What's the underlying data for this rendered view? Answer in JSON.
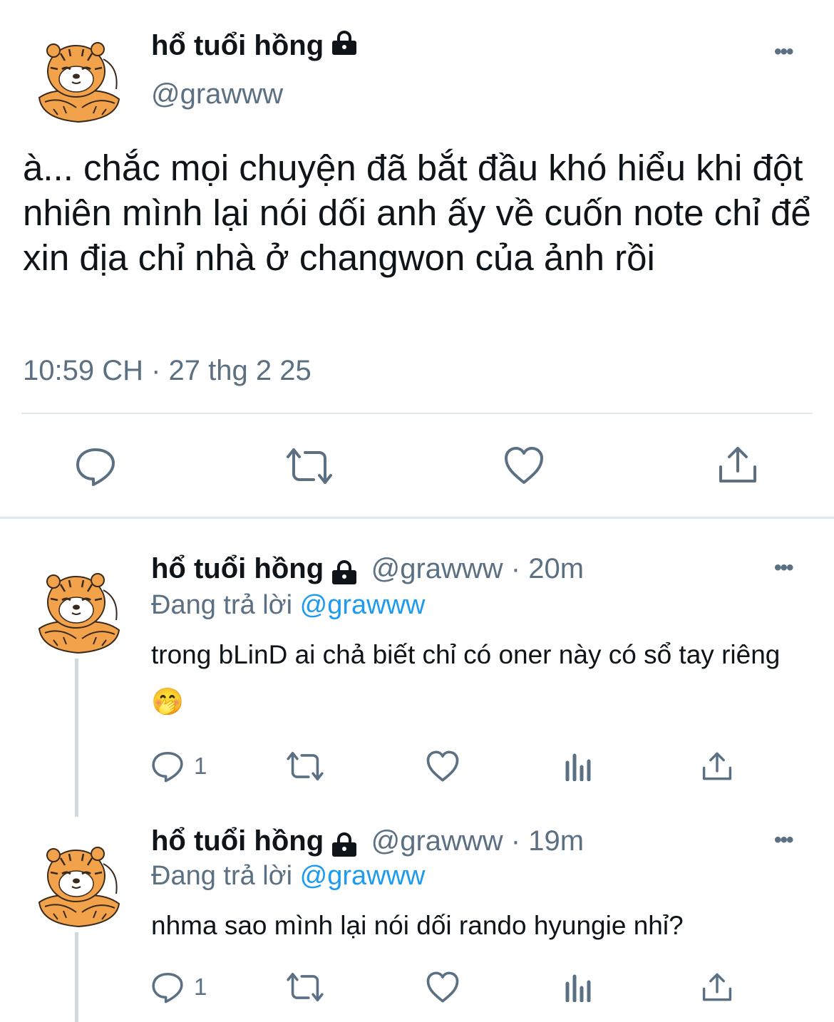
{
  "main_tweet": {
    "display_name": "hổ tuổi hồng",
    "handle": "@grawww",
    "text": "à... chắc mọi chuyện đã bắt đầu khó hiểu khi đột nhiên mình lại nói dối anh ấy về cuốn note chỉ để xin địa chỉ nhà ở changwon của ảnh rồi",
    "timestamp": "10:59 CH · 27 thg 2 25",
    "more_label": "•••"
  },
  "replies": [
    {
      "display_name": "hổ tuổi hồng",
      "meta": "@grawww · 20m",
      "replying_prefix": "Đang trả lời",
      "replying_to": "@grawww",
      "text": "trong bLinD ai chả biết chỉ có oner này có sổ tay riêng 🤭",
      "reply_count": "1",
      "more_label": "•••"
    },
    {
      "display_name": "hổ tuổi hồng",
      "meta": "@grawww · 19m",
      "replying_prefix": "Đang trả lời",
      "replying_to": "@grawww",
      "text": "nhma sao mình lại nói dối rando hyungie nhỉ?",
      "reply_count": "1",
      "more_label": "•••"
    }
  ],
  "icons": {
    "reply": "reply-icon",
    "retweet": "retweet-icon",
    "like": "heart-icon",
    "views": "analytics-icon",
    "share": "share-icon",
    "lock": "lock-icon"
  },
  "colors": {
    "text": "#0f1419",
    "secondary": "#5b7083",
    "link": "#1d9bf0",
    "divider": "#e1e8ed",
    "avatar_orange": "#f0a048"
  }
}
